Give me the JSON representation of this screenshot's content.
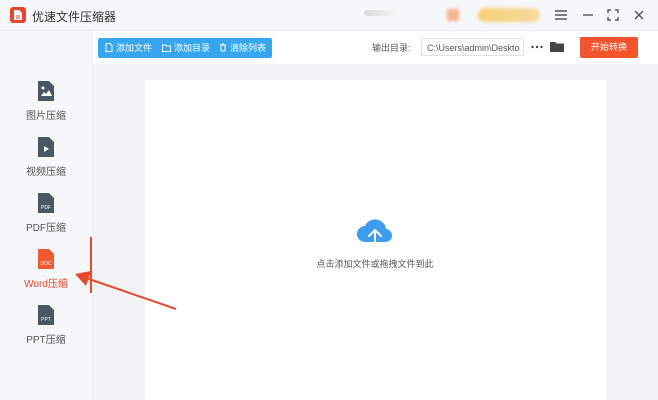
{
  "app": {
    "title": "优速文件压缩器"
  },
  "sidebar": {
    "items": [
      {
        "label": "图片压缩",
        "icon": "image-file-icon"
      },
      {
        "label": "视频压缩",
        "icon": "video-file-icon"
      },
      {
        "label": "PDF压缩",
        "icon": "pdf-file-icon",
        "badge": "PDF"
      },
      {
        "label": "Word压缩",
        "icon": "doc-file-icon",
        "badge": "DOC",
        "active": true
      },
      {
        "label": "PPT压缩",
        "icon": "ppt-file-icon",
        "badge": "PPT"
      }
    ]
  },
  "toolbar": {
    "add_file": "添加文件",
    "add_dir": "添加目录",
    "clear_list": "清除列表",
    "output_label": "输出目录:",
    "output_path": "C:\\Users\\admin\\Deskto",
    "more_label": "•••",
    "start_button": "开始转换"
  },
  "drop_zone": {
    "hint": "点击添加文件或拖拽文件到此"
  },
  "colors": {
    "accent_red": "#e8482f",
    "start_button": "#f2542b",
    "toolbar_blue": "#36a6ef",
    "cloud_blue": "#3d9cf0"
  }
}
